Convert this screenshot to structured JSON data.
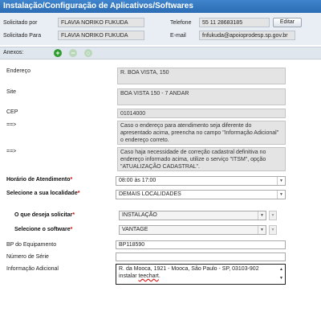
{
  "title": "Instalação/Configuração de Aplicativos/Softwares",
  "header": {
    "solicitado_por_label": "Solicitado por",
    "solicitado_por_value": "FLAVIA NORIKO FUKUDA",
    "solicitado_para_label": "Solicitado Para",
    "solicitado_para_value": "FLAVIA NORIKO FUKUDA",
    "telefone_label": "Telefone",
    "telefone_value": "55 11 28683185",
    "editar_label": "Editar",
    "email_label": "E-mail",
    "email_value": "fnfukuda@apoioprodesp.sp.gov.br"
  },
  "toolbar": {
    "anexos_label": "Anexos:"
  },
  "form": {
    "endereco_label": "Endereço",
    "endereco_value": "R. BOA VISTA, 150",
    "site_label": "Site",
    "site_value": "BOA VISTA 150 - 7 ANDAR",
    "cep_label": "CEP",
    "cep_value": "01014000",
    "note1_arrow": "==>",
    "note1_text": "Caso o endereço para atendimento seja diferente do apresentado acima, preencha no campo \"Informação Adicional\" o endereço correto.",
    "note2_arrow": "==>",
    "note2_text": "Caso haja necessidade de correção cadastral definitiva no endereço informado acima, utilize o serviço \"ITSM\", opção \"ATUALIZAÇÃO CADASTRAL\".",
    "horario_label": "Horário de Atendimento",
    "horario_value": "08:00 às 17:00",
    "localidade_label": "Selecione a sua localidade",
    "localidade_value": "DEMAIS LOCALIDADES",
    "solicitar_label": "O que deseja solicitar",
    "solicitar_value": "INSTALAÇÃO",
    "software_label": "Selecione o software",
    "software_value": "VANTAGE",
    "bp_label": "BP do Equipamento",
    "bp_value": "BP118590",
    "serie_label": "Número de Série",
    "serie_value": "",
    "info_label": "Informação Adicional",
    "info_line1": "R. da Mooca, 1921 - Mooca, São Paulo - SP, 03103-902",
    "info_line2_pre": "instalar ",
    "info_line2_word": "teechart",
    "info_line2_post": "."
  }
}
